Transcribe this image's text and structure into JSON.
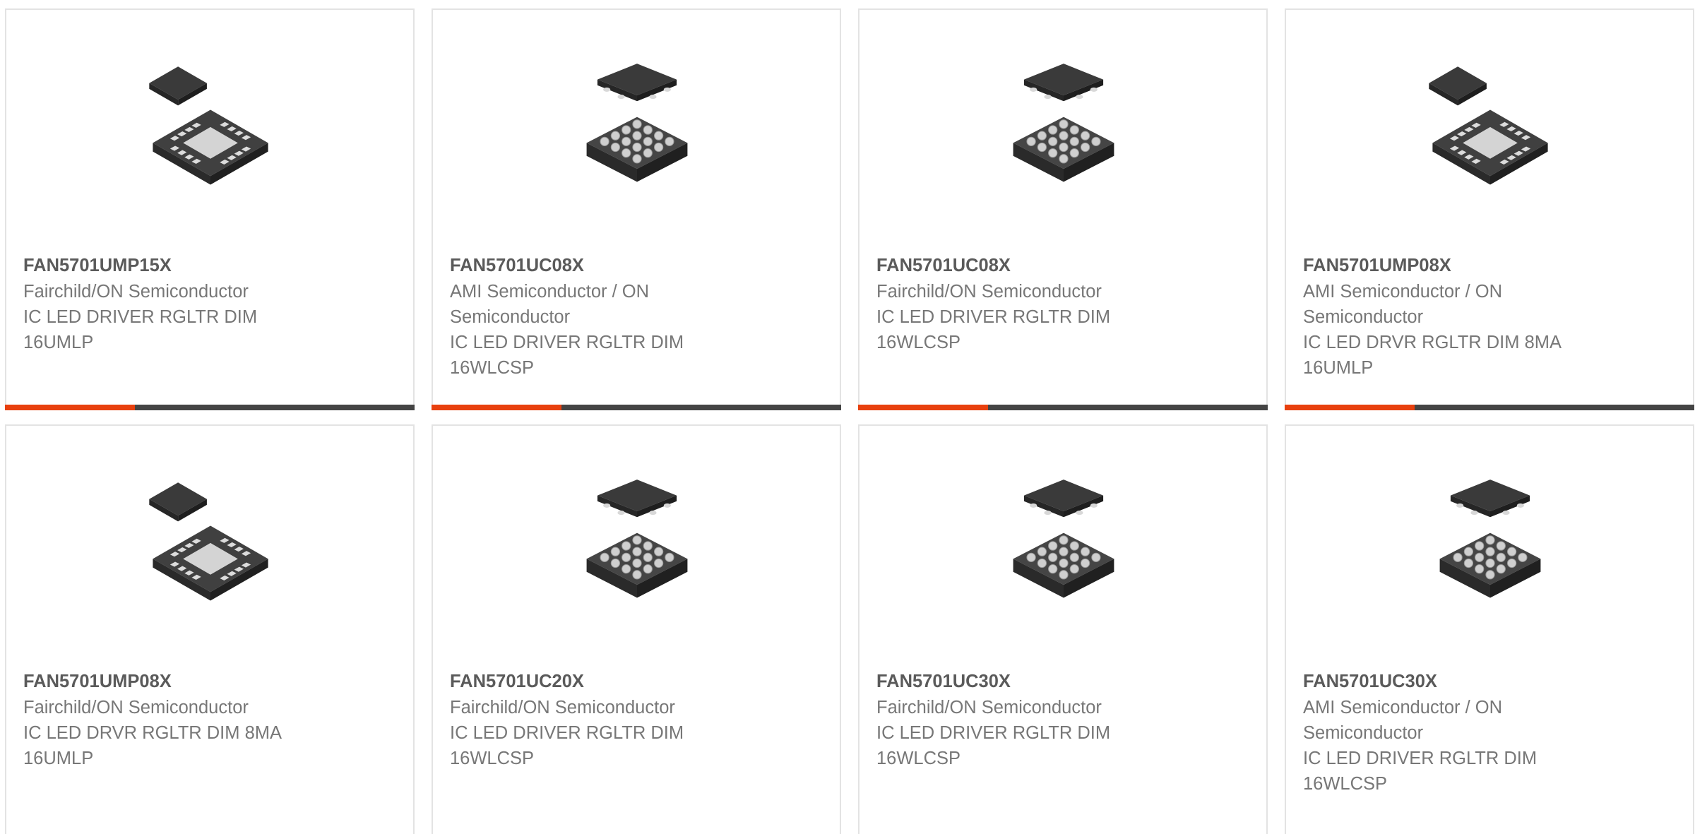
{
  "colors": {
    "accent": "#e8400e",
    "bar": "#444444",
    "border": "#e3e3e3",
    "text": "#777777",
    "title": "#5a5a5a"
  },
  "products": [
    {
      "part_number": "FAN5701UMP15X",
      "manufacturer": "Fairchild/ON Semiconductor",
      "description": "IC LED DRIVER RGLTR DIM 16UMLP",
      "package_icon": "umlp-package-icon"
    },
    {
      "part_number": "FAN5701UC08X",
      "manufacturer": "AMI Semiconductor / ON Semiconductor",
      "description": "IC LED DRIVER RGLTR DIM 16WLCSP",
      "package_icon": "wlcsp-package-icon"
    },
    {
      "part_number": "FAN5701UC08X",
      "manufacturer": "Fairchild/ON Semiconductor",
      "description": "IC LED DRIVER RGLTR DIM 16WLCSP",
      "package_icon": "wlcsp-package-icon"
    },
    {
      "part_number": "FAN5701UMP08X",
      "manufacturer": "AMI Semiconductor / ON Semiconductor",
      "description": "IC LED DRVR RGLTR DIM 8MA 16UMLP",
      "package_icon": "umlp-package-icon"
    },
    {
      "part_number": "FAN5701UMP08X",
      "manufacturer": "Fairchild/ON Semiconductor",
      "description": "IC LED DRVR RGLTR DIM 8MA 16UMLP",
      "package_icon": "umlp-package-icon"
    },
    {
      "part_number": "FAN5701UC20X",
      "manufacturer": "Fairchild/ON Semiconductor",
      "description": "IC LED DRIVER RGLTR DIM 16WLCSP",
      "package_icon": "wlcsp-package-icon"
    },
    {
      "part_number": "FAN5701UC30X",
      "manufacturer": "Fairchild/ON Semiconductor",
      "description": "IC LED DRIVER RGLTR DIM 16WLCSP",
      "package_icon": "wlcsp-package-icon"
    },
    {
      "part_number": "FAN5701UC30X",
      "manufacturer": "AMI Semiconductor / ON Semiconductor",
      "description": "IC LED DRIVER RGLTR DIM 16WLCSP",
      "package_icon": "wlcsp-package-icon"
    }
  ]
}
